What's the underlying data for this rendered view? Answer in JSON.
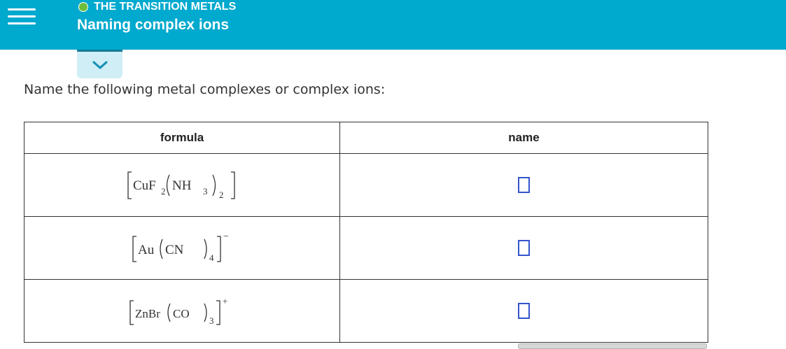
{
  "header": {
    "topic": "THE TRANSITION METALS",
    "title": "Naming complex ions",
    "status_color": "#6dbf3d",
    "bar_color": "#00a9ce"
  },
  "question": {
    "prompt": "Name the following metal complexes or complex ions:",
    "columns": {
      "formula": "formula",
      "name": "name"
    },
    "rows": [
      {
        "formula": {
          "metal": "CuF",
          "metal_sub": "2",
          "ligand": "NH",
          "ligand_sub": "3",
          "group_sub": "2",
          "charge": ""
        },
        "answer": ""
      },
      {
        "formula": {
          "metal": "Au",
          "metal_sub": "",
          "ligand": "CN",
          "ligand_sub": "",
          "group_sub": "4",
          "charge": "−"
        },
        "answer": ""
      },
      {
        "formula": {
          "metal": "ZnBr",
          "metal_sub": "",
          "ligand": "CO",
          "ligand_sub": "",
          "group_sub": "3",
          "charge": "+"
        },
        "answer": ""
      }
    ]
  },
  "icons": {
    "menu": "hamburger-icon",
    "expand": "chevron-down-icon"
  }
}
